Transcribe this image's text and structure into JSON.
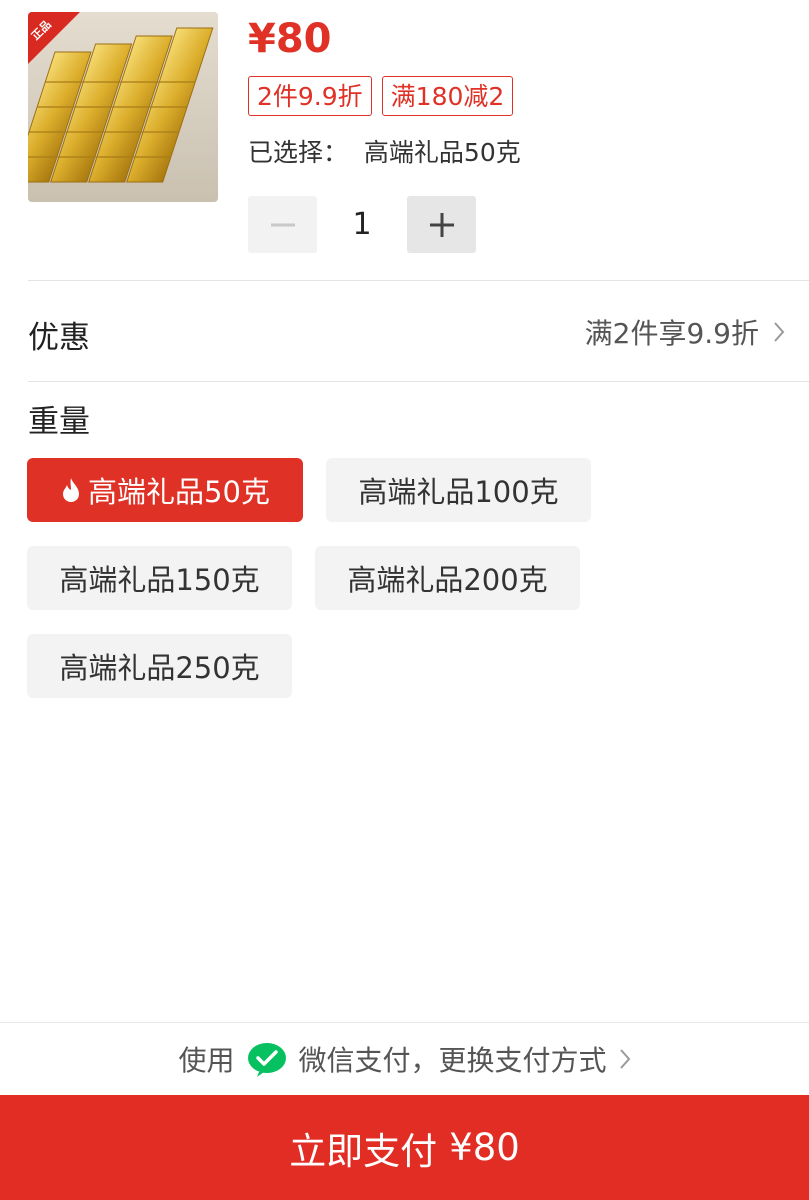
{
  "product": {
    "badge": "正品",
    "price": "¥80",
    "tags": [
      "2件9.9折",
      "满180减2"
    ],
    "selected_label": "已选择：",
    "selected_value": "高端礼品50克",
    "quantity": "1"
  },
  "discount": {
    "label": "优惠",
    "value": "满2件享9.9折"
  },
  "weight": {
    "label": "重量",
    "options": [
      "高端礼品50克",
      "高端礼品100克",
      "高端礼品150克",
      "高端礼品200克",
      "高端礼品250克"
    ],
    "selected_index": 0
  },
  "payment": {
    "prefix": "使用",
    "method": "微信支付，更换支付方式"
  },
  "pay_button": {
    "label": "立即支付",
    "amount": "¥80"
  },
  "colors": {
    "accent": "#e03126",
    "pay_button": "#e22d24",
    "wechat_green": "#07c160"
  }
}
